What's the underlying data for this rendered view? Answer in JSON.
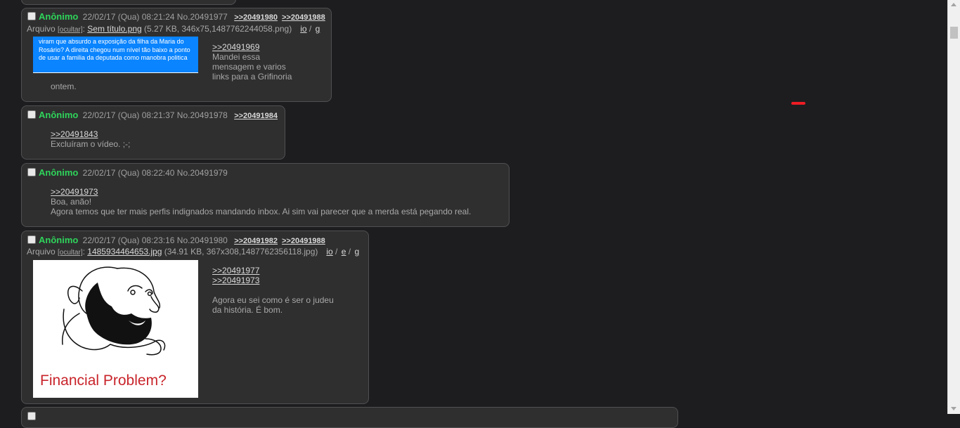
{
  "posts": [
    {
      "name": "Anônimo",
      "date": "22/02/17 (Qua) 08:21:24",
      "number": "No.20491977",
      "backlinks": [
        ">>20491980",
        ">>20491988"
      ],
      "file": {
        "prefix": "Arquivo",
        "hide": "[ocultar]",
        "name": "Sem título.png",
        "meta": "(5.27 KB, 346x75,1487762244058.png)",
        "search": [
          "io",
          "g"
        ],
        "thumb_text": "viram que absurdo a exposição da filha da Maria do Rosário? A direita chegou num nível tão baixo a ponto de usar a familia da deputada como manobra politica"
      },
      "quote": ">>20491969",
      "text_lines": [
        "Mandei essa",
        "mensagem e varios",
        "links para a Grifinoria"
      ],
      "trailing": "ontem."
    },
    {
      "name": "Anônimo",
      "date": "22/02/17 (Qua) 08:21:37",
      "number": "No.20491978",
      "backlinks": [
        ">>20491984"
      ],
      "quote": ">>20491843",
      "text_lines": [
        "Excluíram o vídeo. ;-;"
      ]
    },
    {
      "name": "Anônimo",
      "date": "22/02/17 (Qua) 08:22:40",
      "number": "No.20491979",
      "backlinks": [],
      "quote": ">>20491973",
      "text_lines": [
        "Boa, anão!",
        "Agora temos que ter mais perfis indignados mandando inbox. Ai sim vai parecer que a merda está pegando real."
      ]
    },
    {
      "name": "Anônimo",
      "date": "22/02/17 (Qua) 08:23:16",
      "number": "No.20491980",
      "backlinks": [
        ">>20491982",
        ">>20491988"
      ],
      "file": {
        "prefix": "Arquivo",
        "hide": "[ocultar]",
        "name": "1485934464653.jpg",
        "meta": "(34.91 KB, 367x308,1487762356118.jpg)",
        "search": [
          "io",
          "e",
          "g"
        ],
        "thumb_caption": "Financial Problem?"
      },
      "quotes": [
        ">>20491977",
        ">>20491973"
      ],
      "text_lines": [
        "Agora eu sei como é ser o judeu",
        "da história. É bom."
      ]
    }
  ],
  "colors": {
    "background": "#1d1d1f",
    "post_bg": "#2f2f30",
    "name": "#2fd45a",
    "thumb_blue": "#0a84ff",
    "caption_red": "#c8242a"
  }
}
